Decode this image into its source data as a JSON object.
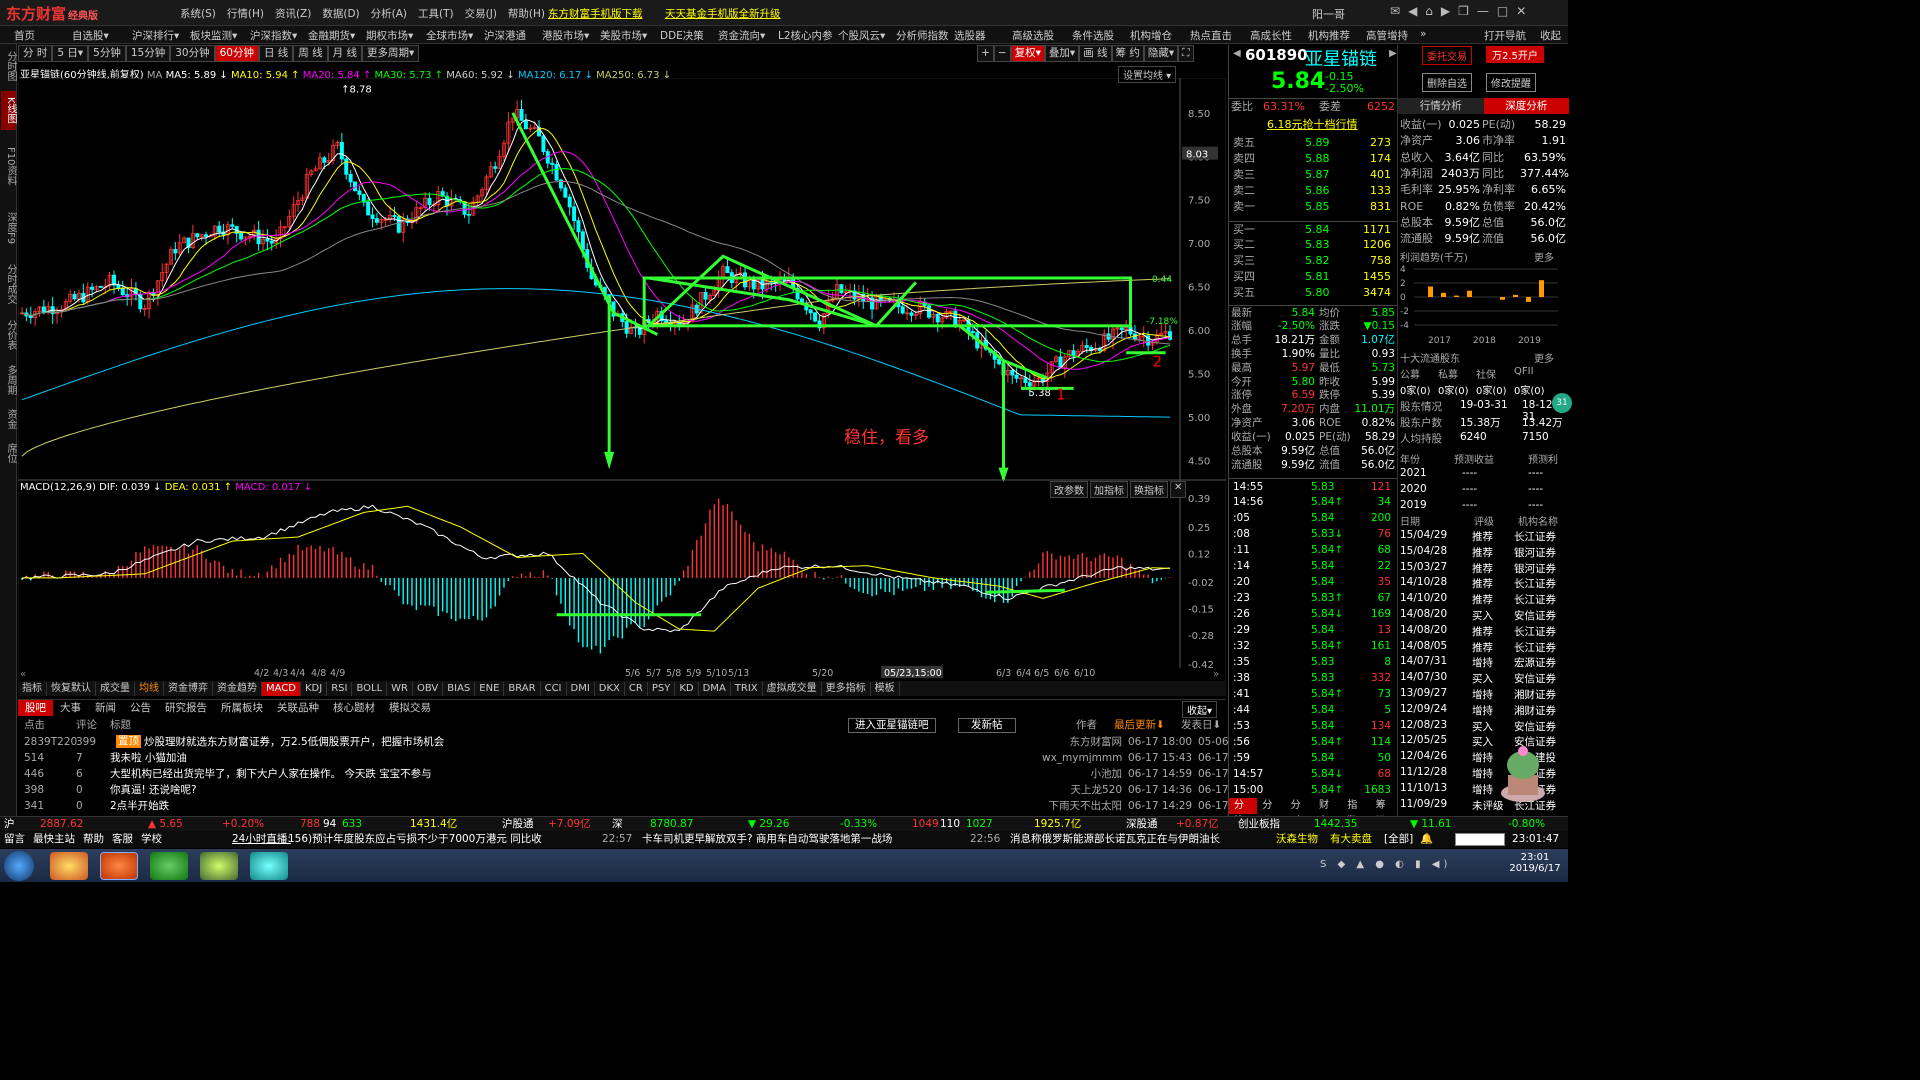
{
  "app": {
    "logo": "东方财富",
    "logo_sub": "经典版"
  },
  "topmenu": [
    "系统(S)",
    "行情(H)",
    "资讯(Z)",
    "数据(D)",
    "分析(A)",
    "工具(T)",
    "交易(J)",
    "帮助(H)"
  ],
  "promo1": "东方财富手机版下载",
  "promo2": "天天基金手机版全新升级",
  "user": "阳一哥",
  "navbar": [
    "首页",
    "自选股▾",
    "沪深排行▾",
    "板块监测▾",
    "沪深指数▾",
    "金融期货▾",
    "期权市场▾",
    "全球市场▾",
    "沪深港通",
    "港股市场▾",
    "美股市场▾",
    "DDE决策",
    "资金流向▾",
    "L2核心内参",
    "个股风云▾",
    "分析师指数",
    "选股器",
    "高级选股",
    "条件选股",
    "机构增仓",
    "热点直击",
    "高成长性",
    "机构推荐",
    "高管增持",
    "»",
    "打开导航",
    "收起"
  ],
  "sidebar": [
    "分时图",
    "K线图",
    "F10资料",
    "深度F9",
    "分时成交",
    "分价表",
    "多周期",
    "资金",
    "席位"
  ],
  "periods": [
    "分 时",
    "5 日▾",
    "5分钟",
    "15分钟",
    "30分钟",
    "60分钟",
    "日 线",
    "周 线",
    "月 线",
    "更多周期▾"
  ],
  "active_period": "60分钟",
  "toolbtns": [
    "+",
    "−",
    "复权▾",
    "叠加▾",
    "画 线",
    "筹 约",
    "隐藏▾",
    "⛶"
  ],
  "chartinfo": {
    "name": "亚星锚链",
    "sub": "(60分钟线,前复权)",
    "ma_label": "MA",
    "ma5": "MA5: 5.89 ↓",
    "ma10": "MA10: 5.94 ↑",
    "ma20": "MA20: 5.84 ↑",
    "ma30": "MA30: 5.73 ↑",
    "ma60": "MA60: 5.92 ↓",
    "ma120": "MA120: 6.17 ↓",
    "ma250": "MA250: 6.73 ↓",
    "setma": "设置均线 ▾"
  },
  "chart_data": {
    "type": "candlestick",
    "ylim": [
      4.3,
      8.9
    ],
    "yticks": [
      "8.50",
      "8.00",
      "7.50",
      "7.00",
      "6.50",
      "6.00",
      "5.50",
      "5.00",
      "4.50"
    ],
    "cursor_price": "8.03",
    "high_label": "8.78",
    "low_label": "5.38",
    "box_labels": [
      "0.44",
      "-7.18%"
    ],
    "annotation": "稳住，看多",
    "marks": [
      "1",
      "2"
    ],
    "xticks": [
      "4/2",
      "4/3",
      "4/4",
      "4/8",
      "4/9",
      "5/6",
      "5/7",
      "5/8",
      "5/9",
      "5/10",
      "5/13",
      "5/20",
      "05/23,15:00",
      "6/3",
      "6/4",
      "6/5",
      "6/6",
      "6/10"
    ],
    "macd": {
      "label": "MACD(12,26,9)",
      "dif": "DIF: 0.039 ↓",
      "dea": "DEA: 0.031 ↑",
      "macd": "MACD: 0.017 ↓",
      "yticks": [
        "0.39",
        "0.25",
        "0.12",
        "-0.02",
        "-0.15",
        "-0.28",
        "-0.42"
      ],
      "ylim": [
        -0.45,
        0.42
      ]
    }
  },
  "macdbtns": [
    "改参数",
    "加指标",
    "换指标",
    "✕"
  ],
  "indicators": [
    "指标",
    "恢复默认",
    "成交量",
    "均线",
    "资金博弈",
    "资金趋势",
    "MACD",
    "KDJ",
    "RSI",
    "BOLL",
    "WR",
    "OBV",
    "BIAS",
    "ENE",
    "BRAR",
    "CCI",
    "DMI",
    "DKX",
    "CR",
    "PSY",
    "KD",
    "DMA",
    "TRIX",
    "虚拟成交量",
    "更多指标",
    "模板"
  ],
  "active_indicator": "MACD",
  "news": {
    "tabs": [
      "股吧",
      "大事",
      "新闻",
      "公告",
      "研究报告",
      "所属板块",
      "关联品种",
      "核心题材",
      "模拟交易"
    ],
    "header": {
      "c1": "点击",
      "c2": "评论",
      "c3": "标题",
      "enter": "进入亚星锚链吧",
      "post": "发新帖",
      "author": "作者",
      "latest": "最后更新⬇",
      "date": "发表日⬇",
      "collapse": "收起▾"
    },
    "rows": [
      {
        "clicks": "2839T220",
        "comments": "399",
        "tag": "置顶",
        "title": "炒股理财就选东方财富证券，万2.5低佣股票开户，把握市场机会",
        "author": "东方财富网",
        "updated": "06-17 18:00",
        "posted": "05-06"
      },
      {
        "clicks": "514",
        "comments": "7",
        "tag": "",
        "title": "我未啦 小猫加油",
        "author": "wx_mymjmmm",
        "updated": "06-17 15:43",
        "posted": "06-17"
      },
      {
        "clicks": "446",
        "comments": "6",
        "tag": "",
        "title": "大型机构已经出货完毕了，剩下大户人家在操作。 今天跌 宝宝不参与",
        "author": "小池加",
        "updated": "06-17 14:59",
        "posted": "06-17"
      },
      {
        "clicks": "398",
        "comments": "0",
        "tag": "",
        "title": "你真逼! 还说啥呢?",
        "author": "天上龙520",
        "updated": "06-17 14:36",
        "posted": "06-17"
      },
      {
        "clicks": "341",
        "comments": "0",
        "tag": "",
        "title": "2点半开始跌",
        "author": "下雨天不出太阳",
        "updated": "06-17 14:29",
        "posted": "06-17"
      }
    ]
  },
  "quote": {
    "code": "601890",
    "name": "亚星锚链",
    "price": "5.84",
    "change": "-0.15",
    "pct": "-2.50%",
    "btn_order": "委托交易",
    "btn_open": "万2.5开户",
    "btn_del": "删除自选",
    "btn_mod": "修改提醒",
    "weibi_label": "委比",
    "weibi": "63.31%",
    "weicha_label": "委差",
    "weicha": "6252",
    "link": "6.18元抢十档行情",
    "asks": [
      {
        "label": "卖五",
        "price": "5.89",
        "vol": "273"
      },
      {
        "label": "卖四",
        "price": "5.88",
        "vol": "174"
      },
      {
        "label": "卖三",
        "price": "5.87",
        "vol": "401"
      },
      {
        "label": "卖二",
        "price": "5.86",
        "vol": "133"
      },
      {
        "label": "卖一",
        "price": "5.85",
        "vol": "831"
      }
    ],
    "bids": [
      {
        "label": "买一",
        "price": "5.84",
        "vol": "1171"
      },
      {
        "label": "买二",
        "price": "5.83",
        "vol": "1206"
      },
      {
        "label": "买三",
        "price": "5.82",
        "vol": "758"
      },
      {
        "label": "买四",
        "price": "5.81",
        "vol": "1455"
      },
      {
        "label": "买五",
        "price": "5.80",
        "vol": "3474"
      }
    ],
    "stats": [
      [
        "最新",
        "5.84",
        "均价",
        "5.85"
      ],
      [
        "涨幅",
        "-2.50%",
        "涨跌",
        "▼0.15"
      ],
      [
        "总手",
        "18.21万",
        "金额",
        "1.07亿"
      ],
      [
        "换手",
        "1.90%",
        "量比",
        "0.93"
      ],
      [
        "最高",
        "5.97",
        "最低",
        "5.73"
      ],
      [
        "今开",
        "5.80",
        "昨收",
        "5.99"
      ],
      [
        "涨停",
        "6.59",
        "跌停",
        "5.39"
      ],
      [
        "外盘",
        "7.20万",
        "内盘",
        "11.01万"
      ],
      [
        "净资产",
        "3.06",
        "ROE",
        "0.82%"
      ],
      [
        "收益(一)",
        "0.025",
        "PE(动)",
        "58.29"
      ],
      [
        "总股本",
        "9.59亿",
        "总值",
        "56.0亿"
      ],
      [
        "流通股",
        "9.59亿",
        "流值",
        "56.0亿"
      ]
    ],
    "ticks": [
      [
        "14:55",
        "5.83",
        "121"
      ],
      [
        "14:56",
        "5.84",
        "34"
      ],
      [
        ":05",
        "5.84",
        "200"
      ],
      [
        ":08",
        "5.83",
        "76"
      ],
      [
        ":11",
        "5.84",
        "68"
      ],
      [
        ":14",
        "5.84",
        "22"
      ],
      [
        ":20",
        "5.84",
        "35"
      ],
      [
        ":23",
        "5.83",
        "67"
      ],
      [
        ":26",
        "5.84",
        "169"
      ],
      [
        ":29",
        "5.84",
        "13"
      ],
      [
        ":32",
        "5.84",
        "161"
      ],
      [
        ":35",
        "5.83",
        "8"
      ],
      [
        ":38",
        "5.83",
        "332"
      ],
      [
        ":41",
        "5.84",
        "73"
      ],
      [
        ":44",
        "5.84",
        "5"
      ],
      [
        ":53",
        "5.84",
        "134"
      ],
      [
        ":56",
        "5.84",
        "114"
      ],
      [
        ":59",
        "5.84",
        "50"
      ],
      [
        "14:57",
        "5.84",
        "68"
      ],
      [
        "15:00",
        "5.84",
        "1683"
      ]
    ],
    "bottomtabs": [
      "分笔",
      "分价",
      "分时",
      "财务",
      "指数",
      "筹码"
    ]
  },
  "fundamentals": {
    "tabs": [
      "行情分析",
      "深度分析"
    ],
    "rows": [
      [
        "收益(一)",
        "0.025",
        "PE(动)",
        "58.29"
      ],
      [
        "净资产",
        "3.06",
        "市净率",
        "1.91"
      ],
      [
        "总收入",
        "3.64亿",
        "同比",
        "63.59%"
      ],
      [
        "净利润",
        "2403万",
        "同比",
        "377.44%"
      ],
      [
        "毛利率",
        "25.95%",
        "净利率",
        "6.65%"
      ],
      [
        "ROE",
        "0.82%",
        "负债率",
        "20.42%"
      ],
      [
        "总股本",
        "9.59亿",
        "总值",
        "56.0亿"
      ],
      [
        "流通股",
        "9.59亿",
        "流值",
        "56.0亿"
      ]
    ],
    "profit_title": "利润趋势(千万)",
    "more": "更多",
    "profit_yticks": [
      "4",
      "2",
      "0",
      "-2",
      "-4"
    ],
    "profit_years": [
      "2017",
      "2018",
      "2019"
    ],
    "profit_values": [
      1.5,
      0.6,
      0.2,
      0.9,
      -0.4,
      0.3,
      -0.7,
      2.4
    ],
    "holders_title": "十大流通股东",
    "holders_cols": [
      "公募",
      "私募",
      "社保",
      "QFII"
    ],
    "holders_vals": [
      "0家(0)",
      "0家(0)",
      "0家(0)",
      "0家(0)"
    ],
    "holders_info": [
      [
        "股东情况",
        "19-03-31",
        "18-12-31"
      ],
      [
        "股东户数",
        "15.38万",
        "13.42万"
      ],
      [
        "人均持股",
        "6240",
        "7150"
      ]
    ],
    "forecast_cols": [
      "年份",
      "预测收益",
      "预测利"
    ],
    "forecast_rows": [
      [
        "2021",
        "----",
        "----"
      ],
      [
        "2020",
        "----",
        "----"
      ],
      [
        "2019",
        "----",
        "----"
      ]
    ],
    "rating_cols": [
      "日期",
      "评级",
      "机构名称"
    ],
    "ratings": [
      [
        "15/04/29",
        "推荐",
        "长江证券"
      ],
      [
        "15/04/28",
        "推荐",
        "银河证券"
      ],
      [
        "15/03/27",
        "推荐",
        "银河证券"
      ],
      [
        "14/10/28",
        "推荐",
        "长江证券"
      ],
      [
        "14/10/20",
        "推荐",
        "长江证券"
      ],
      [
        "14/08/20",
        "买入",
        "安信证券"
      ],
      [
        "14/08/20",
        "推荐",
        "长江证券"
      ],
      [
        "14/08/05",
        "推荐",
        "长江证券"
      ],
      [
        "14/07/31",
        "增持",
        "宏源证券"
      ],
      [
        "14/07/30",
        "买入",
        "安信证券"
      ],
      [
        "13/09/27",
        "增持",
        "湘财证券"
      ],
      [
        "12/09/24",
        "增持",
        "湘财证券"
      ],
      [
        "12/08/23",
        "买入",
        "安信证券"
      ],
      [
        "12/05/25",
        "买入",
        "安信证券"
      ],
      [
        "12/04/26",
        "增持",
        "中金建投"
      ],
      [
        "11/12/28",
        "增持",
        "湘财证券"
      ],
      [
        "11/10/13",
        "增持",
        "湘财证券"
      ],
      [
        "11/09/29",
        "未评级",
        "长江证券"
      ]
    ],
    "badge": "31"
  },
  "statusbar": {
    "sh_label": "沪",
    "sh_idx": "2887.62",
    "sh_chg": "▲ 5.65",
    "sh_pct": "+0.20%",
    "sh_ud": "788",
    "sh_flat": "94",
    "sh_dn": "633",
    "sh_amt": "1431.4亿",
    "hgt_label": "沪股通",
    "hgt_val": "+7.09亿",
    "sz_label": "深",
    "sz_idx": "8780.87",
    "sz_chg": "▼ 29.26",
    "sz_pct": "-0.33%",
    "sz_ud": "1049",
    "sz_flat": "110",
    "sz_dn": "1027",
    "sz_amt": "1925.7亿",
    "sgt_label": "深股通",
    "sgt_val": "+0.87亿",
    "cy_label": "创业板指",
    "cy_idx": "1442.35",
    "cy_chg": "▼ 11.61",
    "cy_pct": "-0.80%"
  },
  "ticker": {
    "items": [
      "留言",
      "最快主站",
      "帮助",
      "客服",
      "学校"
    ],
    "live": "24小时直播:",
    "news1": "156)预计年度股东应占亏损不少于7000万港元 同比收",
    "t1": "22:57",
    "news2": "卡车司机更早解放双手? 商用车自动驾驶落地第一战场",
    "t2": "22:56",
    "news3": "消息称俄罗斯能源部长诺瓦克正在与伊朗油长",
    "stock": "沃森生物",
    "deal": "有大卖盘",
    "all": "[全部]",
    "time": "23:01:47"
  },
  "taskbar": {
    "clock_time": "23:01",
    "clock_date": "2019/6/17"
  },
  "colors": {
    "up": "#f33",
    "down": "#0ff",
    "ma5": "#fff",
    "ma10": "#ff0",
    "ma20": "#f0f",
    "ma30": "#0f0",
    "ma60": "#888",
    "ma120": "#0cf",
    "ma250": "#cc6",
    "annot": "#33ff33"
  }
}
